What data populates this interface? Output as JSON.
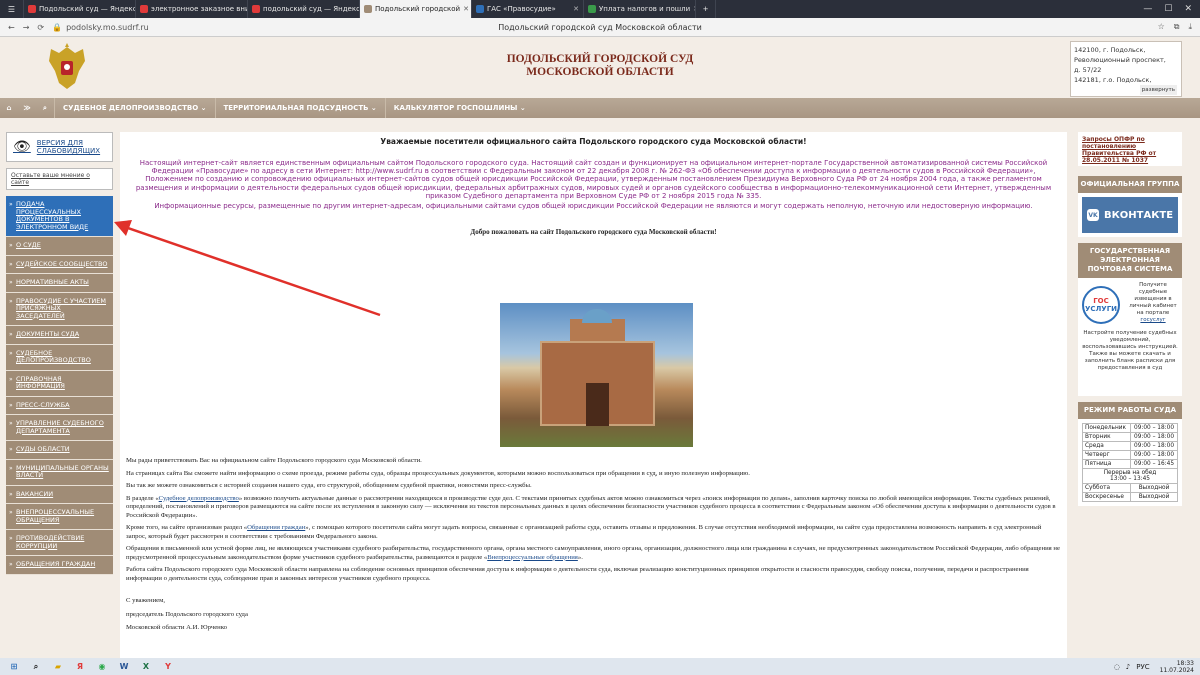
{
  "tabs": [
    {
      "label": "Подольский суд — Яндекс",
      "color": "#e03a3a"
    },
    {
      "label": "электронное заказное вни",
      "color": "#e03a3a"
    },
    {
      "label": "подольский суд — Яндекс",
      "color": "#e03a3a"
    },
    {
      "label": "Подольский городской",
      "color": "#a08c76",
      "active": true
    },
    {
      "label": "ГАС «Правосудие»",
      "color": "#2e6fb8"
    },
    {
      "label": "Уплата налогов и пошли",
      "color": "#3a9a4a"
    }
  ],
  "address": {
    "url": "podolsky.mo.sudrf.ru",
    "page_title": "Подольский городской суд Московской области"
  },
  "header": {
    "court_line1": "ПОДОЛЬСКИЙ ГОРОДСКОЙ СУД",
    "court_line2": "МОСКОВСКОЙ ОБЛАСТИ",
    "addr_lines": [
      "142100, г. Подольск,",
      "Революционный проспект,",
      "д. 57/22",
      "142181, г.о. Подольск,"
    ],
    "expand": "развернуть"
  },
  "menu": {
    "items": [
      "СУДЕБНОЕ ДЕЛОПРОИЗВОДСТВО ⌄",
      "ТЕРРИТОРИАЛЬНАЯ ПОДСУДНОСТЬ ⌄",
      "КАЛЬКУЛЯТОР ГОСПОШЛИНЫ ⌄"
    ]
  },
  "left": {
    "version": "ВЕРСИЯ ДЛЯ СЛАБОВИДЯЩИХ",
    "opinion": "Оставьте ваше мнение о сайте",
    "items": [
      "ПОДАЧА ПРОЦЕССУАЛЬНЫХ ДОКУМЕНТОВ В ЭЛЕКТРОННОМ ВИДЕ",
      "О СУДЕ",
      "СУДЕЙСКОЕ СООБЩЕСТВО",
      "НОРМАТИВНЫЕ АКТЫ",
      "ПРАВОСУДИЕ С УЧАСТИЕМ ПРИСЯЖНЫХ ЗАСЕДАТЕЛЕЙ",
      "ДОКУМЕНТЫ СУДА",
      "СУДЕБНОЕ ДЕЛОПРОИЗВОДСТВО",
      "СПРАВОЧНАЯ ИНФОРМАЦИЯ",
      "ПРЕСС-СЛУЖБА",
      "УПРАВЛЕНИЕ СУДЕБНОГО ДЕПАРТАМЕНТА",
      "СУДЫ ОБЛАСТИ",
      "МУНИЦИПАЛЬНЫЕ ОРГАНЫ ВЛАСТИ",
      "ВАКАНСИИ",
      "ВНЕПРОЦЕССУАЛЬНЫЕ ОБРАЩЕНИЯ",
      "ПРОТИВОДЕЙСТВИЕ КОРРУПЦИИ",
      "ОБРАЩЕНИЯ ГРАЖДАН"
    ]
  },
  "main": {
    "title": "Уважаемые посетители официального сайта Подольского городского суда Московской области!",
    "intro1": "Настоящий интернет-сайт является единственным официальным сайтом Подольского городского суда. Настоящий сайт создан и функционирует на официальном интернет-портале Государственной автоматизированной системы Российской Федерации «Правосудие» по адресу в сети Интернет: http://www.sudrf.ru в соответствии с Федеральным законом от 22 декабря 2008 г. № 262-ФЗ «Об обеспечении доступа к информации о деятельности судов в Российской Федерации», Положением по созданию и сопровождению официальных интернет-сайтов судов общей юрисдикции Российской Федерации, утвержденным постановлением Президиума Верховного Суда РФ от 24 ноября 2004 года, а также регламентом размещения и информации о деятельности федеральных судов общей юрисдикции, федеральных арбитражных судов, мировых судей и органов судейского сообщества в информационно-телекоммуникационной сети Интернет, утвержденным приказом Судебного департамента при Верховном Суде РФ от 2 ноября 2015 года № 335.",
    "intro2": "Информационные ресурсы, размещенные по другим интернет-адресам, официальными сайтами судов общей юрисдикции Российской Федерации не являются и могут содержать неполную, неточную или недостоверную информацию.",
    "welcome": "Добро пожаловать на сайт Подольского городского суда Московской области!",
    "p1": "Мы рады приветствовать Вас на официальном сайте Подольского городского суда Московской области.",
    "p2": "На страницах сайта Вы сможете найти информацию о схеме проезда, режиме работы суда, образцы процессуальных документов, которыми можно воспользоваться при обращении в суд, и иную полезную информацию.",
    "p3": "Вы так же можете ознакомиться с историей создания нашего суда, его структурой, обобщением судебной практики, новостями пресс-службы.",
    "p4a": "В разделе «",
    "p4link": "Судебное делопроизводство",
    "p4b": "» возможно получить актуальные данные о рассмотрении находящихся в производстве суде дел. С текстами принятых судебных актов можно ознакомиться через «поиск информации по делам», заполнив карточку поиска по любой имеющейся информации. Тексты судебных решений, определений, постановлений и приговоров размещаются на сайте после их вступления в законную силу — исключения из текстов персональных данных в целях обеспечения безопасности участников судебного процесса в соответствии с Федеральным законом «Об обеспечении доступа к информации о деятельности судов в Российской Федерации».",
    "p5a": "Кроме того, на сайте организован раздел «",
    "p5link": "Обращения граждан",
    "p5b": "», с помощью которого посетители сайта могут задать вопросы, связанные с организацией работы суда, оставить отзывы и предложения. В случае отсутствия необходимой информации, на сайте суда предоставлена возможность направить в суд электронный запрос, который будет рассмотрен в соответствии с требованиями Федерального закона.",
    "p6a": "Обращения в письменной или устной форме лиц, не являющихся участниками судебного разбирательства, государственного органа, органа местного самоуправления, иного органа, организации, должностного лица или гражданина в случаях, не предусмотренных законодательством Российской Федерации, либо обращения не предусмотренной процессуальным законодательством форме участников судебного разбирательства, размещаются в разделе «",
    "p6link": "Внепроцессуальные обращения",
    "p6b": "».",
    "p7": "Работа сайта Подольского городского суда Московской области направлена на соблюдение основных принципов обеспечения доступа к информации о деятельности суда, включая реализацию конституционных принципов открытости и гласности правосудия, свободу поиска, получения, передачи и распространения информации о деятельности суда, соблюдение прав и законных интересов участников судебного процесса.",
    "sig1": "С уважением,",
    "sig2": "председатель Подольского городского суда",
    "sig3": "Московской области А.И. Юрченко"
  },
  "right": {
    "link": "Запросы ОПФР по постановлению Правительства РФ от 28.05.2011 № 1037",
    "group_head": "ОФИЦИАЛЬНАЯ ГРУППА",
    "vk": "ВКОНТАКТЕ",
    "post_head": "ГОСУДАРСТВЕННАЯ ЭЛЕКТРОННАЯ ПОЧТОВАЯ СИСТЕМА",
    "gos_logo1": "ГОС",
    "gos_logo2": "УСЛУГИ",
    "gos_text1": "Получите судебные извещения в личный кабинет на портале",
    "gos_link": "госуслуг",
    "gos_text2": "Настройте получение судебных уведомлений, воспользовавшись инструкцией. Также вы можете скачать и заполнить бланк расписки для предоставления в суд",
    "sched_head": "РЕЖИМ РАБОТЫ СУДА",
    "schedule": [
      [
        "Понедельник",
        "09:00 – 18:00"
      ],
      [
        "Вторник",
        "09:00 – 18:00"
      ],
      [
        "Среда",
        "09:00 – 18:00"
      ],
      [
        "Четверг",
        "09:00 – 18:00"
      ],
      [
        "Пятница",
        "09:00 – 16:45"
      ]
    ],
    "break_label": "Перерыв на обед",
    "break_time": "13:00 – 13:45",
    "weekend": [
      [
        "Суббота",
        "Выходной"
      ],
      [
        "Воскресенье",
        "Выходной"
      ]
    ]
  },
  "taskbar": {
    "lang": "РУС",
    "time": "18:33",
    "date": "11.07.2024"
  }
}
